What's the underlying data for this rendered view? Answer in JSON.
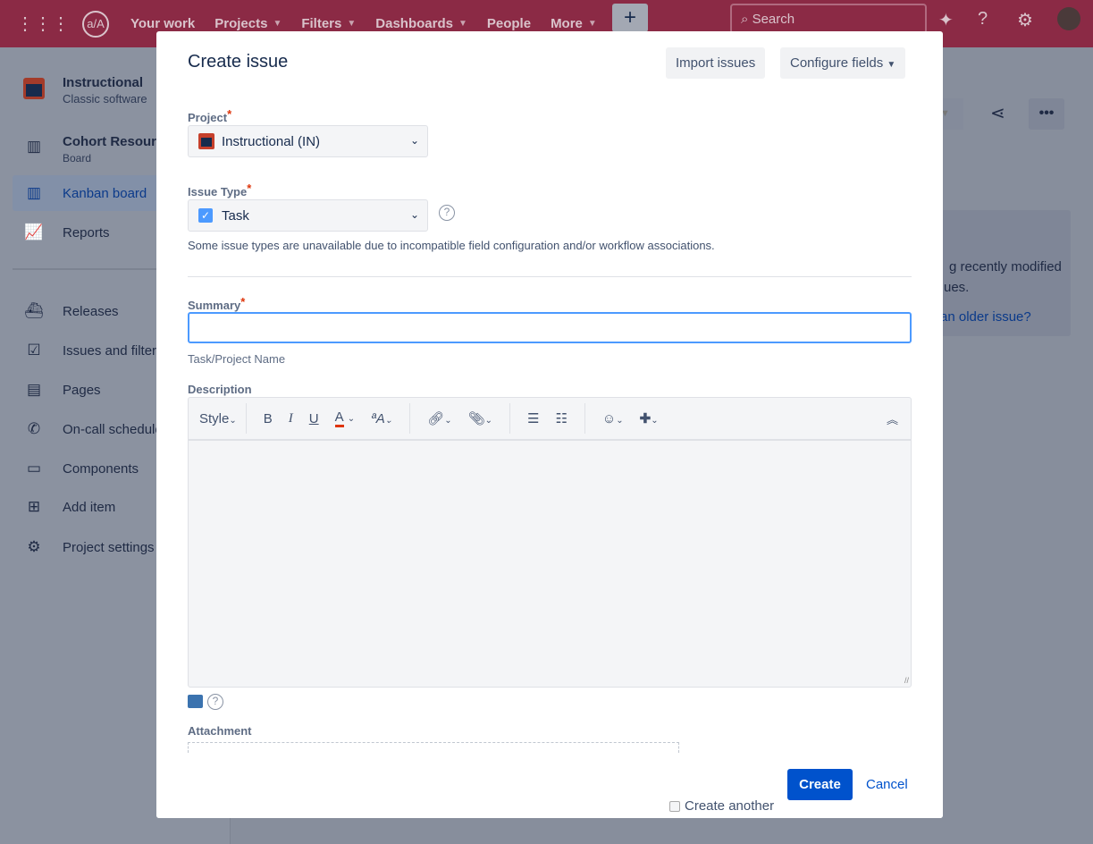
{
  "topnav": {
    "items": [
      "Your work",
      "Projects",
      "Filters",
      "Dashboards",
      "People",
      "More"
    ],
    "logo": "a/A",
    "create": "+",
    "search_placeholder": "Search"
  },
  "sidebar": {
    "project_name": "Instructional",
    "project_type": "Classic software",
    "items": [
      {
        "label": "Cohort Resources",
        "sub": "Board",
        "icon": "board-icon"
      },
      {
        "label": "Kanban board",
        "icon": "kanban-icon"
      },
      {
        "label": "Reports",
        "icon": "chart-icon"
      },
      {
        "label": "Releases",
        "icon": "ship-icon"
      },
      {
        "label": "Issues and filters",
        "icon": "issues-icon"
      },
      {
        "label": "Pages",
        "icon": "page-icon"
      },
      {
        "label": "On-call schedule",
        "icon": "phone-icon"
      },
      {
        "label": "Components",
        "icon": "component-icon"
      },
      {
        "label": "Add item",
        "icon": "add-item-icon"
      },
      {
        "label": "Project settings",
        "icon": "gear-icon"
      }
    ]
  },
  "background": {
    "line1": "g recently modified",
    "line2": "ues.",
    "link": "an older issue?"
  },
  "modal": {
    "title": "Create issue",
    "import_btn": "Import issues",
    "configure_btn": "Configure fields",
    "project_label": "Project",
    "project_value": "Instructional (IN)",
    "type_label": "Issue Type",
    "type_value": "Task",
    "type_note": "Some issue types are unavailable due to incompatible field configuration and/or workflow associations.",
    "summary_label": "Summary",
    "summary_value": "",
    "summary_hint": "Task/Project Name",
    "description_label": "Description",
    "toolbar": {
      "style": "Style",
      "bold": "B",
      "italic": "I",
      "underline": "U",
      "color": "A",
      "more_text": "ªA"
    },
    "attachment_label": "Attachment",
    "create_another": "Create another",
    "create_btn": "Create",
    "cancel_btn": "Cancel"
  },
  "colors": {
    "accent": "#0052cc",
    "focus": "#4c9aff",
    "required": "#de350b",
    "header": "#8b2a45"
  }
}
